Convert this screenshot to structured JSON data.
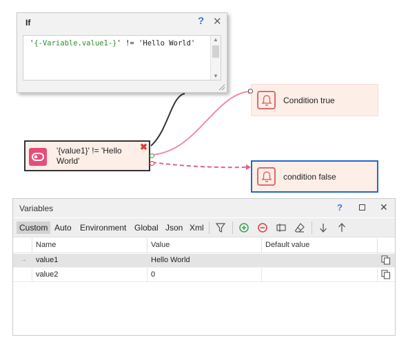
{
  "if_dialog": {
    "title": "If",
    "help_label": "?",
    "close_label": "✕",
    "code_prefix": "'",
    "code_variable": "{-Variable.value1-}",
    "code_suffix": "' != 'Hello World'"
  },
  "action_block": {
    "label": "'{value1}' != 'Hello World'",
    "delete_label": "✖"
  },
  "nodes": {
    "true_label": "Condition true",
    "false_label": "condition false"
  },
  "variables_panel": {
    "title": "Variables",
    "help_label": "?",
    "close_label": "✕",
    "tabs": [
      "Custom",
      "Auto",
      "Environment",
      "Global",
      "Json",
      "Xml"
    ],
    "active_tab": "Custom",
    "columns": [
      "Name",
      "Value",
      "Default value"
    ],
    "rows": [
      {
        "name": "value1",
        "value": "Hello World",
        "default": "",
        "selected": true
      },
      {
        "name": "value2",
        "value": "0",
        "default": "",
        "selected": false
      }
    ]
  },
  "colors": {
    "accent_pink": "#e74c78",
    "true_wire": "#f08aa8",
    "false_wire": "#e85a8a",
    "selected_node_border": "#2266cc"
  }
}
